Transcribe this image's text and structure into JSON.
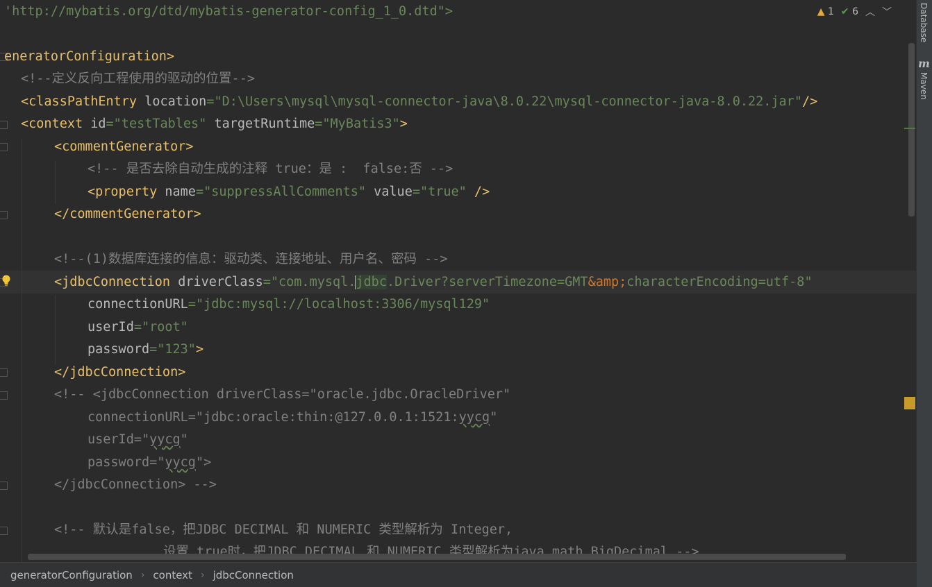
{
  "status": {
    "warnings": "1",
    "checks": "6",
    "prev_icon": "chevron-up-icon",
    "next_icon": "chevron-down-icon"
  },
  "side_panels": [
    "Database",
    "Maven"
  ],
  "colors": {
    "background": "#2b2b2b",
    "tag": "#e8bf6a",
    "string": "#6a8759",
    "comment": "#808080",
    "attribute": "#bababa",
    "entity": "#cc7832"
  },
  "code": {
    "l1": "'http://mybatis.org/dtd/mybatis-generator-config_1_0.dtd\">",
    "l3": "eneratorConfiguration>",
    "l4": "<!--定义反向工程使用的驱动的位置-->",
    "l5": {
      "tag": "<classPathEntry",
      "attr": " location",
      "eq": "=",
      "val": "\"D:\\Users\\mysql\\mysql-connector-java\\8.0.22\\mysql-connector-java-8.0.22.jar\"",
      "end": "/>"
    },
    "l6": {
      "tag": "<context",
      "a1": " id",
      "v1": "\"testTables\"",
      "a2": " targetRuntime",
      "v2": "\"MyBatis3\"",
      "end": ">"
    },
    "l7": "<commentGenerator>",
    "l8": "<!-- 是否去除自动生成的注释 true：是 :  false:否 -->",
    "l9": {
      "tag": "<property",
      "a1": " name",
      "v1": "\"suppressAllComments\"",
      "a2": " value",
      "v2": "\"true\"",
      "end": " />"
    },
    "l10": "</commentGenerator>",
    "l12": "<!--(1)数据库连接的信息：驱动类、连接地址、用户名、密码 -->",
    "l13": {
      "tag": "<jdbcConnection",
      "attr": " driverClass",
      "v_pre": "\"com.mysql.",
      "v_hl": "jdbc",
      "v_mid": ".Driver?serverTimezone=GMT",
      "ent": "&amp;",
      "v_post": "characterEncoding=utf-8\""
    },
    "l14": {
      "attr": "connectionURL",
      "val": "\"jdbc:mysql://localhost:3306/mysql129\""
    },
    "l15": {
      "attr": "userId",
      "val": "\"root\""
    },
    "l16": {
      "attr": "password",
      "val": "\"123\"",
      "end": ">"
    },
    "l17": "</jdbcConnection>",
    "l18": "<!-- <jdbcConnection driverClass=\"oracle.jdbc.OracleDriver\"",
    "l19_pre": "connectionURL=\"jdbc:oracle:thin:@127.0.0.1:1521:",
    "l19_sq": "yycg",
    "l19_post": "\"",
    "l20_pre": "userId=\"",
    "l20_sq": "yycg",
    "l20_post": "\"",
    "l21_pre": "password=\"",
    "l21_sq": "yycg",
    "l21_post": "\">",
    "l22": "</jdbcConnection> -->",
    "l24": "<!-- 默认是false，把JDBC DECIMAL 和 NUMERIC 类型解析为 Integer,",
    "l25": "设置 true时，把JDBC DECIMAL 和 NUMERIC 类型解析为java.math.BigDecimal -->"
  },
  "breadcrumb": [
    "generatorConfiguration",
    "context",
    "jdbcConnection"
  ]
}
